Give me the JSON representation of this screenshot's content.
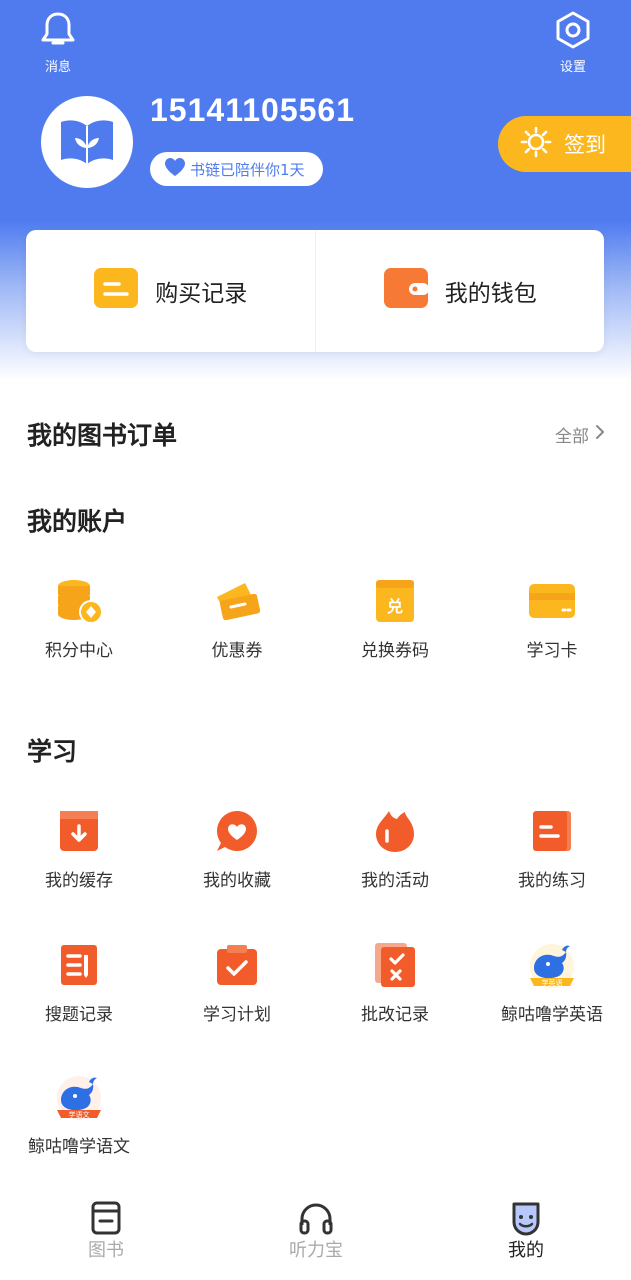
{
  "header": {
    "notifications_label": "消息",
    "settings_label": "设置",
    "phone": "15141105561",
    "badge_text": "书链已陪伴你1天",
    "signin_label": "签到"
  },
  "quick_actions": {
    "purchase_label": "购买记录",
    "wallet_label": "我的钱包"
  },
  "orders": {
    "title": "我的图书订单",
    "all_label": "全部"
  },
  "account": {
    "title": "我的账户",
    "items": [
      {
        "label": "积分中心",
        "icon": "coins-icon"
      },
      {
        "label": "优惠券",
        "icon": "coupon-icon"
      },
      {
        "label": "兑换券码",
        "icon": "redeem-code-icon"
      },
      {
        "label": "学习卡",
        "icon": "study-card-icon"
      }
    ]
  },
  "study": {
    "title": "学习",
    "items": [
      {
        "label": "我的缓存",
        "icon": "download-cache-icon"
      },
      {
        "label": "我的收藏",
        "icon": "heart-favorite-icon"
      },
      {
        "label": "我的活动",
        "icon": "activity-flame-icon"
      },
      {
        "label": "我的练习",
        "icon": "practice-book-icon"
      },
      {
        "label": "搜题记录",
        "icon": "search-record-icon"
      },
      {
        "label": "学习计划",
        "icon": "study-plan-icon"
      },
      {
        "label": "批改记录",
        "icon": "grading-record-icon"
      },
      {
        "label": "鲸咕噜学英语",
        "icon": "whale-english-icon",
        "tag": "学英语"
      },
      {
        "label": "鲸咕噜学语文",
        "icon": "whale-chinese-icon",
        "tag": "学语文"
      }
    ]
  },
  "tabbar": {
    "tabs": [
      {
        "label": "图书",
        "icon": "book-icon"
      },
      {
        "label": "听力宝",
        "icon": "headphones-icon"
      },
      {
        "label": "我的",
        "icon": "profile-face-icon"
      }
    ],
    "active_index": 2
  },
  "colors": {
    "primary_blue": "#4f7bef",
    "signin_yellow": "#fbb71d",
    "icon_orange": "#f25c2a",
    "icon_yellow": "#fbb71d"
  }
}
